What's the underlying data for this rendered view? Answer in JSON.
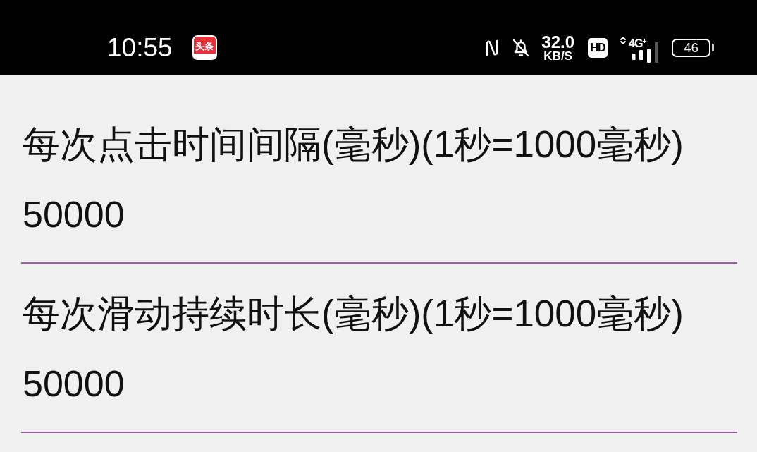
{
  "status_bar": {
    "time": "10:55",
    "app_logo_text": "头条",
    "network_speed": "32.0",
    "network_speed_unit": "KB/S",
    "hd_badge": "HD",
    "network_type": "4G$^{+}$",
    "battery": "46"
  },
  "fields": [
    {
      "label": "每次点击时间间隔(毫秒)(1秒=1000毫秒)",
      "value": "50000"
    },
    {
      "label": "每次滑动持续时长(毫秒)(1秒=1000毫秒)",
      "value": "50000"
    }
  ]
}
